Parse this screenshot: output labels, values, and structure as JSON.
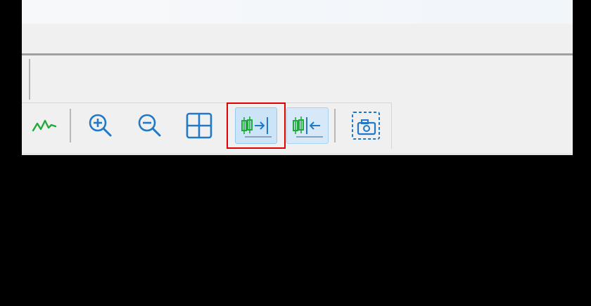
{
  "colors": {
    "accent_blue": "#1f78c8",
    "accent_green": "#1faa3a",
    "highlight_red": "#e00000",
    "background": "#000000"
  },
  "toolbar": {
    "buttons": [
      {
        "name": "indicator-button",
        "icon": "line-chart-icon",
        "state": "normal"
      },
      {
        "name": "zoom-in-button",
        "icon": "zoom-in-icon",
        "state": "normal"
      },
      {
        "name": "zoom-out-button",
        "icon": "zoom-out-icon",
        "state": "normal"
      },
      {
        "name": "tile-windows-button",
        "icon": "grid-icon",
        "state": "normal"
      },
      {
        "name": "chart-shift-button",
        "icon": "chart-shift-icon",
        "state": "active",
        "highlighted": true
      },
      {
        "name": "auto-scroll-button",
        "icon": "auto-scroll-icon",
        "state": "pressed"
      },
      {
        "name": "screenshot-button",
        "icon": "camera-icon",
        "state": "normal"
      }
    ]
  }
}
